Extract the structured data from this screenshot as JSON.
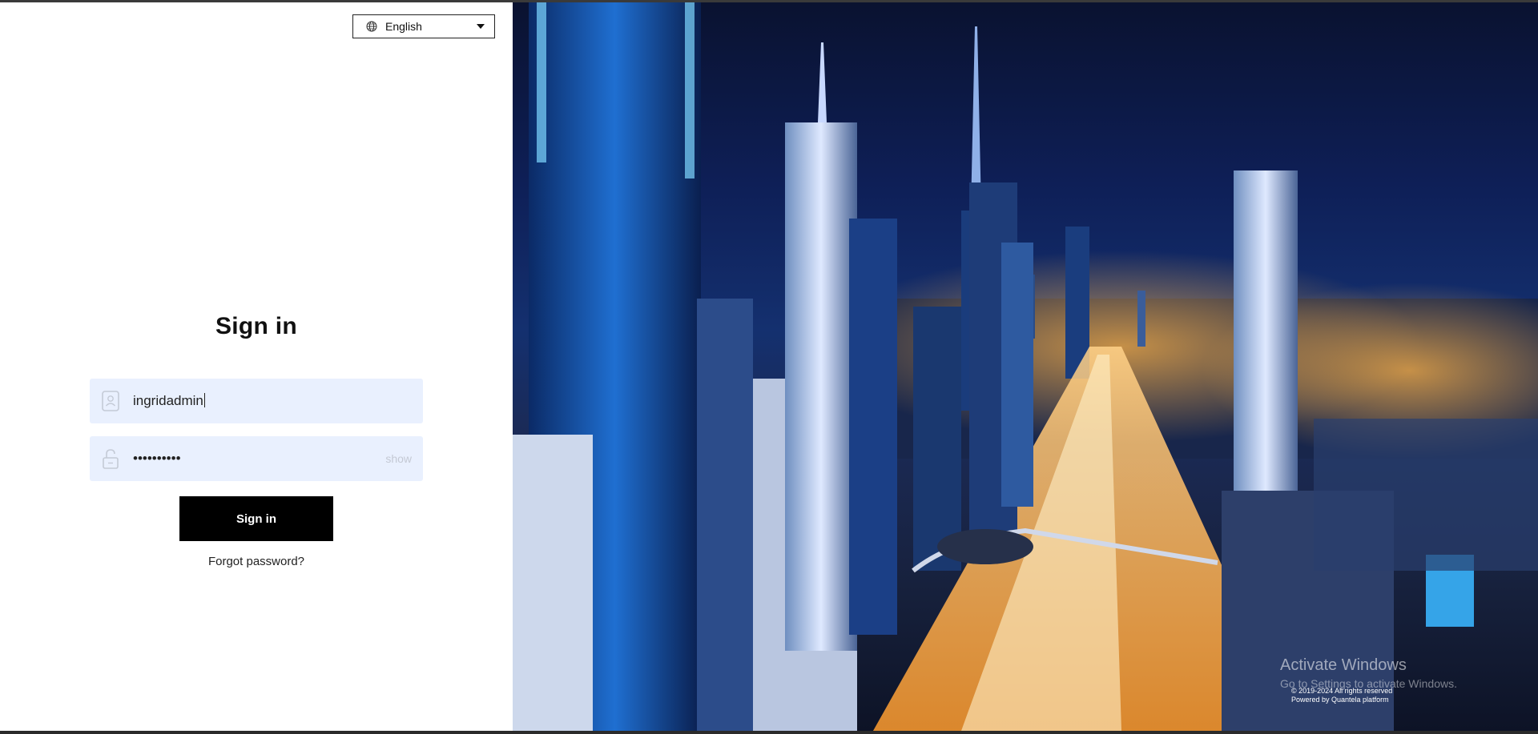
{
  "language": {
    "selected": "English"
  },
  "signin": {
    "title": "Sign in",
    "username_value": "ingridadmin",
    "password_masked": "••••••••••",
    "show_label": "show",
    "button_label": "Sign in",
    "forgot_label": "Forgot password?"
  },
  "overlay": {
    "activate_title": "Activate Windows",
    "activate_sub": "Go to Settings to activate Windows.",
    "copyright": "© 2019-2024 All rights reserved",
    "powered": "Powered by Quantela platform"
  },
  "icons": {
    "language": "globe-icon",
    "caret": "chevron-down-icon",
    "username": "id-card-icon",
    "password": "lock-icon"
  },
  "colors": {
    "button_bg": "#000000",
    "field_bg": "#e9f0fe",
    "sky": "#0e1f57",
    "city_glow": "#ffb347"
  }
}
